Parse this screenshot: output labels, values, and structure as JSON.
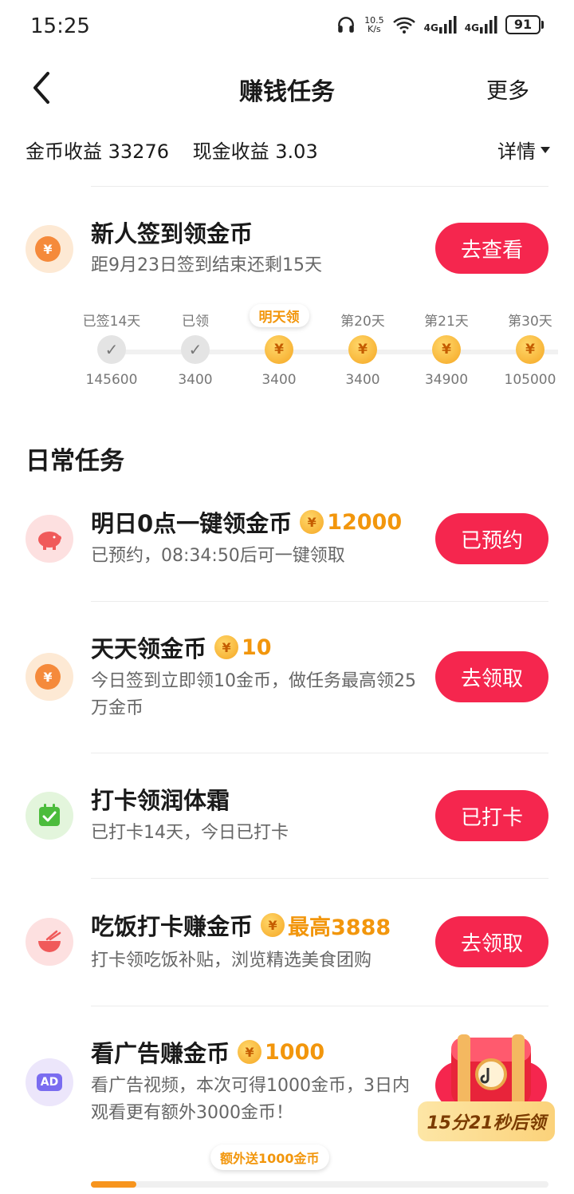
{
  "status_bar": {
    "time": "15:25",
    "net_speed_value": "10.5",
    "net_speed_unit": "K/s",
    "signal_1": "4G",
    "signal_2": "4G",
    "battery": "91"
  },
  "nav": {
    "title": "赚钱任务",
    "more": "更多"
  },
  "earnings": {
    "coin_label": "金币收益",
    "coin_value": "33276",
    "cash_label": "现金收益",
    "cash_value": "3.03",
    "detail": "详情"
  },
  "signin": {
    "title": "新人签到领金币",
    "desc": "距9月23日签到结束还剩15天",
    "button": "去查看",
    "steps": [
      {
        "label": "已签14天",
        "value": "145600",
        "state": "done"
      },
      {
        "label": "已领",
        "value": "3400",
        "state": "done"
      },
      {
        "label": "明天领",
        "value": "3400",
        "state": "tomorrow"
      },
      {
        "label": "第20天",
        "value": "3400",
        "state": "coin"
      },
      {
        "label": "第21天",
        "value": "34900",
        "state": "coin"
      },
      {
        "label": "第30天",
        "value": "105000",
        "state": "coins"
      }
    ]
  },
  "daily": {
    "section_title": "日常任务",
    "tasks": [
      {
        "icon": "piggy-bank-icon",
        "title": "明日0点一键领金币",
        "reward": "12000",
        "desc": "已预约，08:34:50后可一键领取",
        "button": "已预约"
      },
      {
        "icon": "yuan-coin-icon",
        "title": "天天领金币",
        "reward": "10",
        "desc": "今日签到立即领10金币，做任务最高领25万金币",
        "button": "去领取"
      },
      {
        "icon": "calendar-check-icon",
        "title": "打卡领润体霜",
        "reward": "",
        "desc": "已打卡14天，今日已打卡",
        "button": "已打卡"
      },
      {
        "icon": "bowl-icon",
        "title": "吃饭打卡赚金币",
        "reward": "最高3888",
        "desc": "打卡领吃饭补贴，浏览精选美食团购",
        "button": "去领取"
      },
      {
        "icon": "ad-icon",
        "title": "看广告赚金币",
        "reward": "1000",
        "desc": "看广告视频，本次可得1000金币，3日内观看更有额外3000金币！",
        "button": ""
      }
    ],
    "ad_timer": "15分21秒后领",
    "ad_bonus": "额外送1000金币",
    "ad_progress": 0.1,
    "ad_icon_text": "AD"
  },
  "colors": {
    "accent_red": "#f5264e",
    "coin_orange": "#f2960c"
  }
}
